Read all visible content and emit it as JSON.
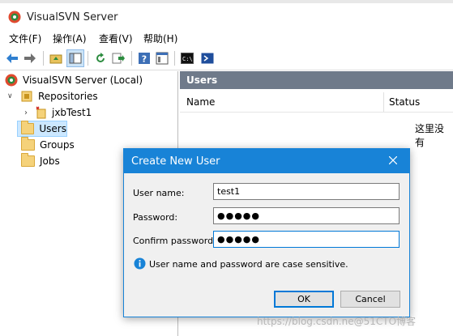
{
  "window": {
    "title": "VisualSVN Server"
  },
  "menu": [
    "文件(F)",
    "操作(A)",
    "查看(V)",
    "帮助(H)"
  ],
  "toolbar_icons": [
    "back-arrow-icon",
    "forward-arrow-icon",
    "up-folder-icon",
    "show-tree-icon",
    "refresh-icon",
    "export-icon",
    "help-icon",
    "properties-icon",
    "console-icon",
    "powershell-icon"
  ],
  "tree": {
    "root": "VisualSVN Server (Local)",
    "repositories": "Repositories",
    "repo_items": [
      "jxbTest1"
    ],
    "users": "Users",
    "groups": "Groups",
    "jobs": "Jobs"
  },
  "pane": {
    "header": "Users",
    "col_name": "Name",
    "col_status": "Status",
    "empty_text": "这里没有"
  },
  "dialog": {
    "title": "Create New User",
    "user_name_label": "User name:",
    "user_name_value": "test1",
    "password_label": "Password:",
    "password_value": "●●●●●",
    "confirm_label": "Confirm password:",
    "confirm_value": "●●●●●",
    "info": "User name and password are case sensitive.",
    "ok": "OK",
    "cancel": "Cancel"
  },
  "watermark": "https://blog.csdn.ne@51CTO博客",
  "colors": {
    "accent": "#1883d7",
    "pane_header": "#6f7a8a",
    "selection": "#cce8ff"
  }
}
